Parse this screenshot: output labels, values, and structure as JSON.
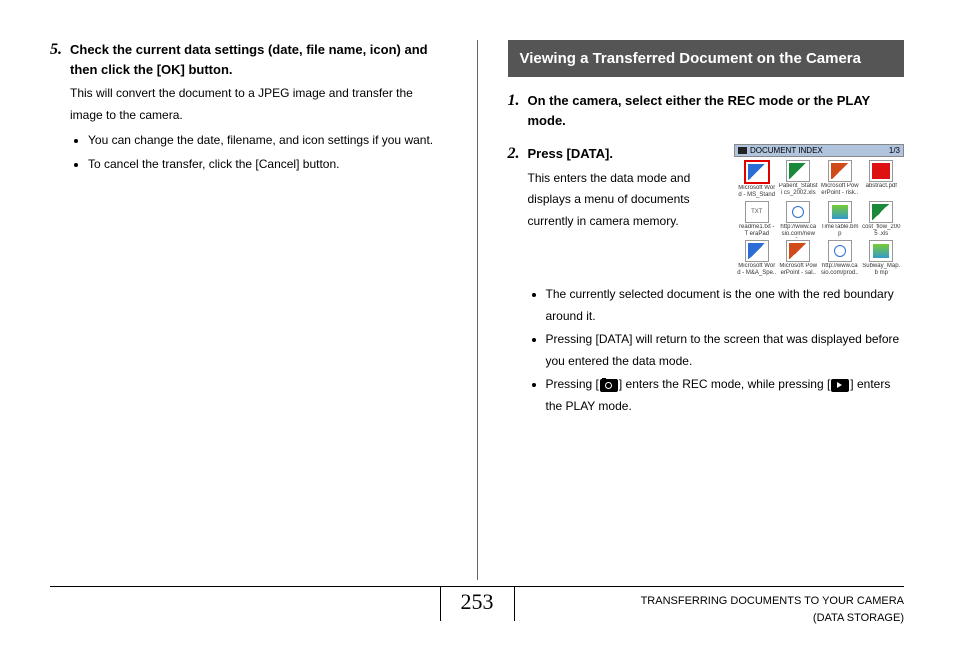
{
  "left": {
    "step5": {
      "num": "5.",
      "title": "Check the current data settings (date, file name, icon) and then click the [OK] button.",
      "desc": "This will convert the document to a JPEG image and transfer the image to the camera.",
      "bullets": [
        "You can change the date, filename, and icon settings if you want.",
        "To cancel the transfer, click the [Cancel] button."
      ]
    }
  },
  "right": {
    "section_title": "Viewing a Transferred Document on the Camera",
    "step1": {
      "num": "1.",
      "title": "On the camera, select either the REC mode or the PLAY mode."
    },
    "step2": {
      "num": "2.",
      "title": "Press [DATA].",
      "desc": "This enters the data mode and displays a menu of documents currently in camera memory.",
      "bullets_a": "The currently selected document is the one with the red boundary around it.",
      "bullets_b": "Pressing [DATA] will return to the screen that was displayed before you entered the data mode.",
      "bullets_c_pre": "Pressing [",
      "bullets_c_mid": "] enters the REC mode, while pressing [",
      "bullets_c_post": "] enters the PLAY mode."
    },
    "screenshot": {
      "title": "DOCUMENT INDEX",
      "page": "1/3",
      "items": [
        {
          "label": "Microsoft Wor d - MS_Stand",
          "cls": "ic-word",
          "sel": true
        },
        {
          "label": "Patient_Statisti cs_2002.xls",
          "cls": "ic-excel"
        },
        {
          "label": "Microsoft Pow erPoint - risk..",
          "cls": "ic-ppt"
        },
        {
          "label": "abstract.pdf",
          "cls": "ic-pdf"
        },
        {
          "label": "readme1.txt - T eraPad",
          "cls": "ic-txt"
        },
        {
          "label": "http://www.ca sio.com/news..",
          "cls": "ic-web"
        },
        {
          "label": "TimeTable.bmp",
          "cls": "ic-bmp"
        },
        {
          "label": "cost_flow_2005 .xls",
          "cls": "ic-excel"
        },
        {
          "label": "Microsoft Wor d - M&A_Spe..",
          "cls": "ic-word"
        },
        {
          "label": "Microsoft Pow erPoint - sal..",
          "cls": "ic-ppt"
        },
        {
          "label": "http://www.ca sio.com/prod..",
          "cls": "ic-web"
        },
        {
          "label": "Subway_Map.b mp",
          "cls": "ic-bmp"
        }
      ]
    }
  },
  "footer": {
    "page_num": "253",
    "line1": "TRANSFERRING DOCUMENTS TO YOUR CAMERA",
    "line2": "(DATA STORAGE)"
  }
}
